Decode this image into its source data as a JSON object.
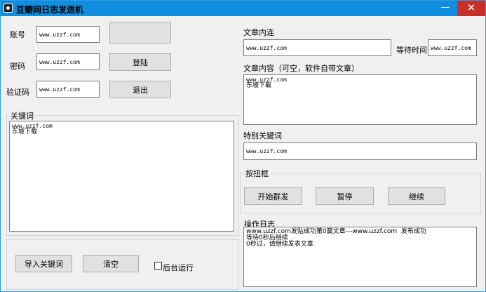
{
  "window": {
    "title": "豆瓣网日志发送机",
    "minimize_glyph": "—",
    "close_glyph": "✕"
  },
  "login": {
    "account_label": "账号",
    "account_value": "www.uzzf.com",
    "password_label": "密码",
    "password_value": "www.uzzf.com",
    "captcha_label": "验证码",
    "captcha_value": "www.uzzf.com",
    "login_button": "登陆",
    "logout_button": "退出"
  },
  "keywords": {
    "group_label": "关键词",
    "lines": [
      "www.uzzf.com",
      "东坡下载"
    ],
    "import_button": "导入关键词",
    "clear_button": "清空",
    "background_label": "后台运行",
    "background_checked": false
  },
  "article": {
    "link_label": "文章内连",
    "link_value": "www.uzzf.com",
    "wait_label": "等待时间",
    "wait_value": "www.uzzf.com",
    "content_label": "文章内容（可空，软件自带文章）",
    "content_lines": [
      "www.uzzf.com",
      "东坡下载"
    ],
    "special_label": "特别关键词",
    "special_value": "www.uzzf.com"
  },
  "controls": {
    "group_label": "按扭框",
    "start_button": "开始群发",
    "pause_button": "暂停",
    "continue_button": "继续"
  },
  "log": {
    "group_label": "操作日志",
    "lines": [
      "www.uzzf.com发贴成功第0篇文章---www.uzzf.com  发布成功",
      "等待0秒后继续",
      "0秒过，请继续发表文章"
    ]
  }
}
